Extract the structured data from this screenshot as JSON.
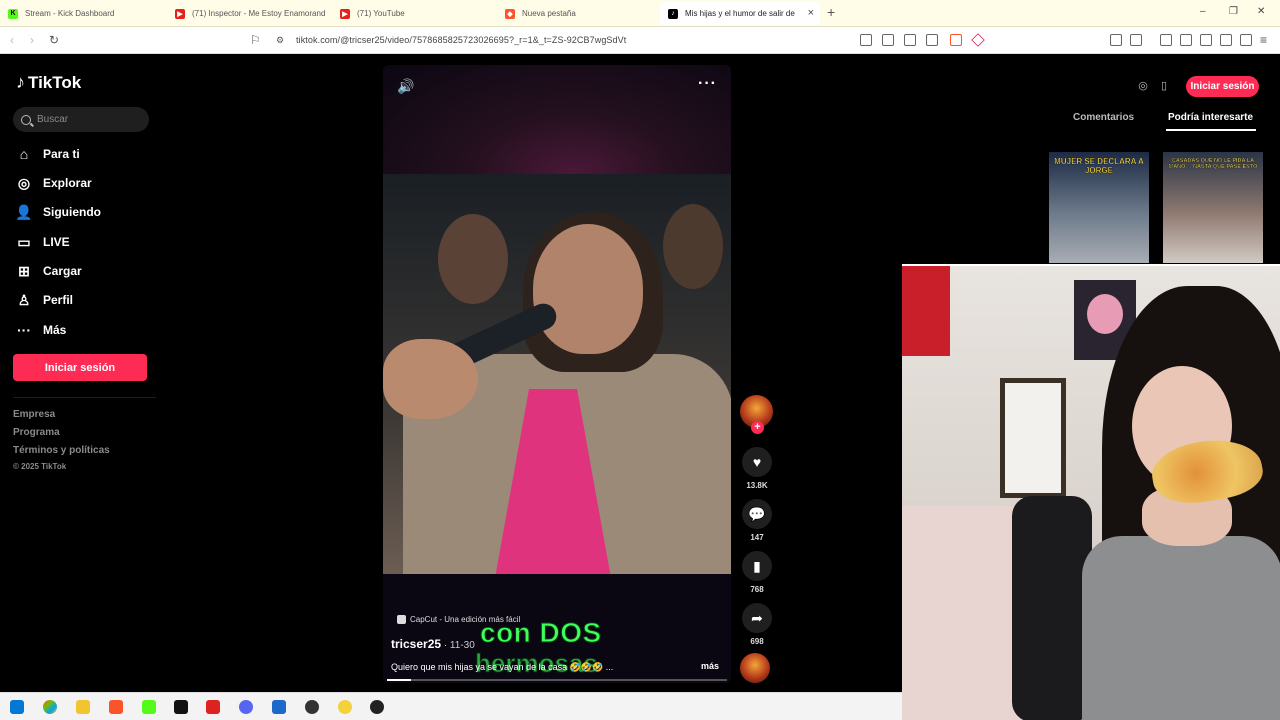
{
  "browser": {
    "tabs": [
      {
        "label": "Stream - Kick Dashboard",
        "icon": "kick-icon",
        "active": false
      },
      {
        "label": "(71) Inspector - Me Estoy Enamorand",
        "icon": "youtube-icon",
        "active": false
      },
      {
        "label": "(71) YouTube",
        "icon": "youtube-icon",
        "active": false
      },
      {
        "label": "Nueva pestaña",
        "icon": "brave-icon",
        "active": false
      },
      {
        "label": "Mis hijas y el humor de salir de",
        "icon": "tiktok-icon",
        "active": true
      }
    ],
    "url": "tiktok.com/@tricser25/video/7578685825723026695?_r=1&_t=ZS-92CB7wgSdVt",
    "new_tab": "+",
    "close": "×",
    "minimize": "–",
    "maximize": "❐",
    "window_close": "✕"
  },
  "sidebar": {
    "logo": "TikTok",
    "search_placeholder": "Buscar",
    "nav": [
      {
        "label": "Para ti",
        "icon": "home-icon"
      },
      {
        "label": "Explorar",
        "icon": "compass-icon"
      },
      {
        "label": "Siguiendo",
        "icon": "following-icon"
      },
      {
        "label": "LIVE",
        "icon": "live-icon"
      },
      {
        "label": "Cargar",
        "icon": "upload-icon"
      },
      {
        "label": "Perfil",
        "icon": "profile-icon"
      },
      {
        "label": "Más",
        "icon": "more-icon"
      }
    ],
    "login": "Iniciar sesión",
    "footer": [
      "Empresa",
      "Programa",
      "Términos y políticas"
    ],
    "copyright": "© 2025 TikTok"
  },
  "video": {
    "capcut": "CapCut - Una edición más fácil",
    "author": "tricser25",
    "date": " · 11-30",
    "caption": "Quiero que mis hijas ya se vayan de la casa 🤣🤣🤣 ...",
    "more": "más",
    "overlay_line1": "con DOS",
    "overlay_line2": "hermosas",
    "progress": 0.07
  },
  "actions": {
    "likes": "13.8K",
    "comments": "147",
    "saves": "768",
    "shares": "698"
  },
  "right": {
    "login": "Iniciar sesión",
    "tab_comments": "Comentarios",
    "tab_recommended": "Podría interesarte",
    "thumb1_text": "MUJER SE DECLARA A JORGE",
    "thumb2_text": "CASADAS QUE NO LE PIDA LA MANO ... NASTA QUE PASE ESTO"
  },
  "colors": {
    "accent": "#fe2c55",
    "overlay_green": "#3cff5a"
  }
}
